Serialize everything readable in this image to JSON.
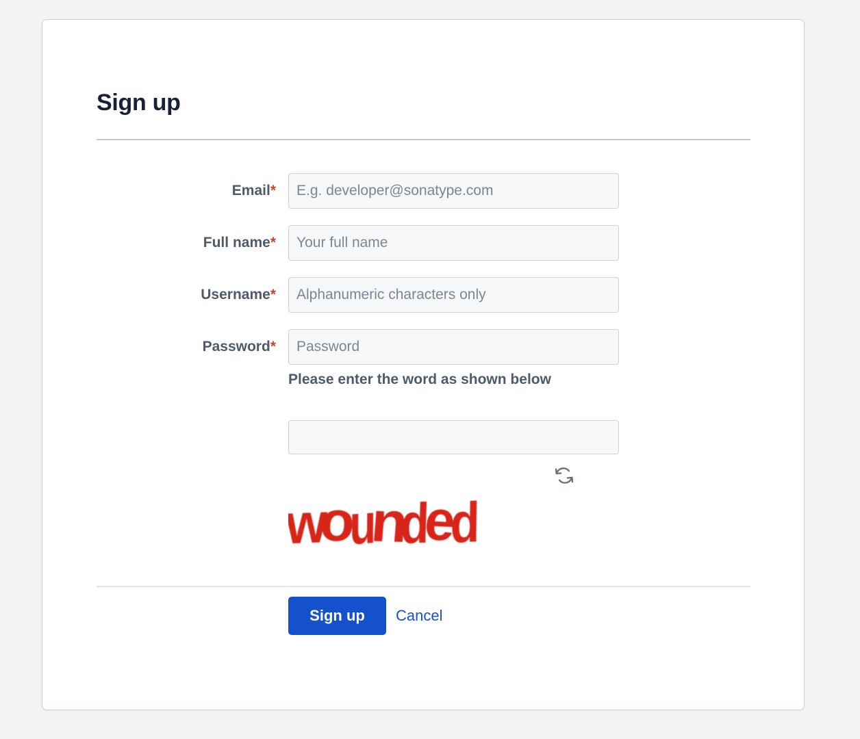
{
  "page": {
    "background_color": "#f1f3f5",
    "card_background": "#ffffff"
  },
  "form": {
    "title": "Sign up",
    "required_marker": "*",
    "fields": [
      {
        "label": "Email",
        "placeholder": "E.g. developer@sonatype.com",
        "value": "",
        "required": true
      },
      {
        "label": "Full name",
        "placeholder": "Your full name",
        "value": "",
        "required": true
      },
      {
        "label": "Username",
        "placeholder": "Alphanumeric characters only",
        "value": "",
        "required": true
      },
      {
        "label": "Password",
        "placeholder": "Password",
        "value": "",
        "required": true
      }
    ],
    "captcha": {
      "prompt": "Please enter the word as shown below",
      "input_value": "",
      "input_placeholder": "",
      "word": "wounded",
      "word_color": "#d8251a",
      "refresh_icon": "refresh-icon"
    },
    "actions": {
      "submit_label": "Sign up",
      "cancel_label": "Cancel",
      "submit_color": "#1451cc",
      "link_color": "#1451cc"
    }
  },
  "colors": {
    "title": "#18203a",
    "label": "#4d5a6b",
    "required_star": "#d2452f",
    "placeholder": "#7b8694",
    "input_border": "#ced3d8",
    "input_background": "#f7f8fa",
    "divider_top": "#c7ccd1",
    "divider_bottom": "#e2e4e6",
    "card_border": "#ccd0d4"
  }
}
